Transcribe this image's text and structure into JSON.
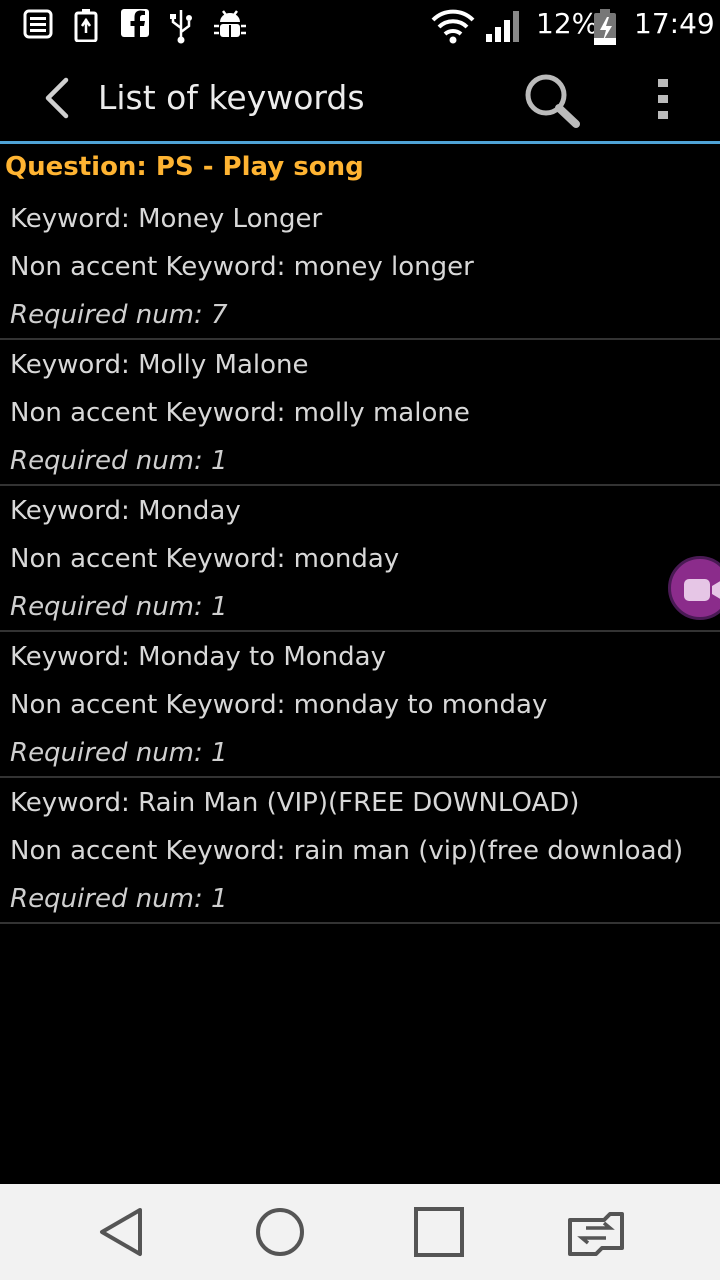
{
  "status_bar": {
    "battery_percent": "12%",
    "time": "17:49",
    "icons": [
      "notes-icon",
      "battery-saver-icon",
      "facebook-icon",
      "usb-icon",
      "android-debug-icon",
      "wifi-icon",
      "signal-icon",
      "battery-charging-icon"
    ]
  },
  "action_bar": {
    "title": "List of keywords",
    "icons": [
      "back-icon",
      "search-icon",
      "overflow-menu-icon"
    ]
  },
  "question_header": "Question: PS - Play song",
  "keywords": [
    {
      "keyword": "Keyword: Money Longer",
      "non_accent": "Non accent Keyword: money longer",
      "required": "Required num: 7"
    },
    {
      "keyword": "Keyword: Molly Malone",
      "non_accent": "Non accent Keyword: molly malone",
      "required": "Required num: 1"
    },
    {
      "keyword": "Keyword: Monday",
      "non_accent": "Non accent Keyword: monday",
      "required": "Required num: 1"
    },
    {
      "keyword": "Keyword: Monday to Monday",
      "non_accent": "Non accent Keyword: monday to monday",
      "required": "Required num: 1"
    },
    {
      "keyword": "Keyword: Rain Man (VIP)(FREE DOWNLOAD)",
      "non_accent": "Non accent Keyword: rain man (vip)(free download)",
      "required": "Required num: 1"
    }
  ],
  "nav_bar": {
    "icons": [
      "nav-back-icon",
      "nav-home-icon",
      "nav-recents-icon",
      "nav-switch-icon"
    ]
  },
  "colors": {
    "accent_line": "#4fa3d6",
    "question_color": "#ffb432",
    "float_button": "#8b2c8b"
  }
}
